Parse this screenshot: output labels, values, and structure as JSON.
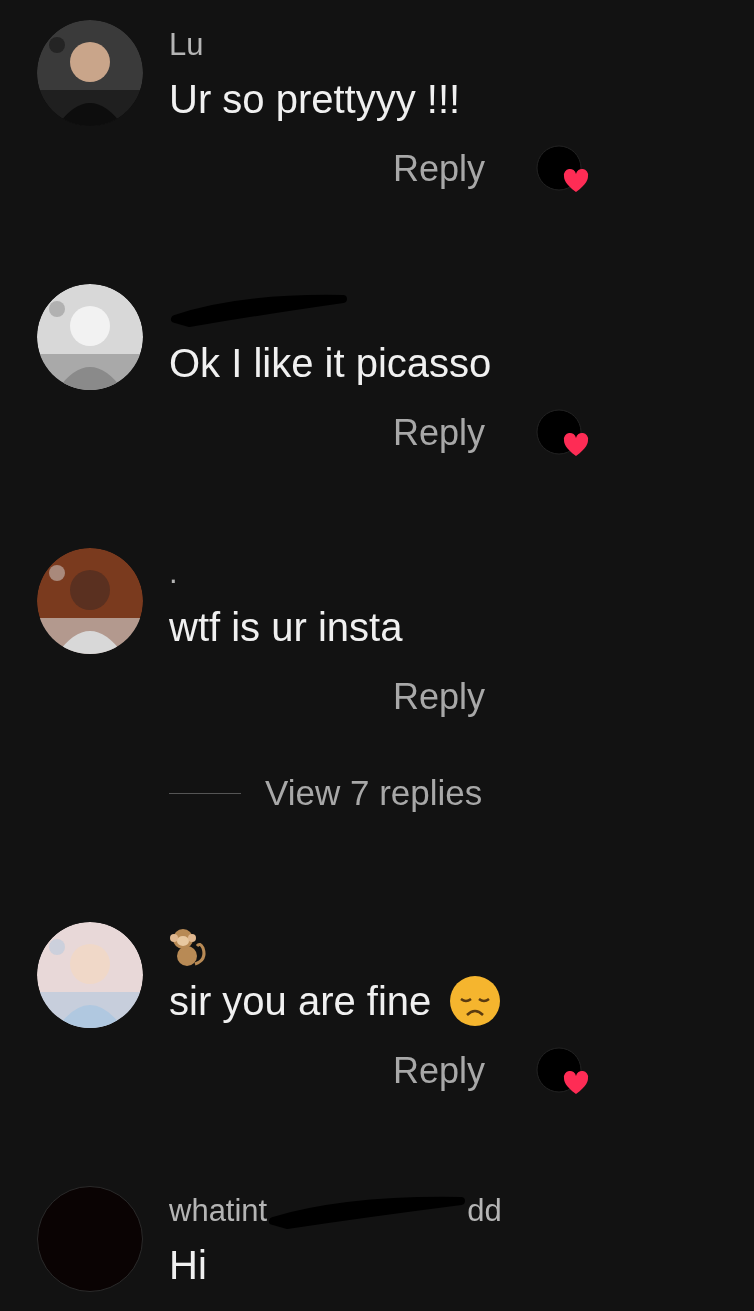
{
  "comments": [
    {
      "username": {
        "kind": "text",
        "text": "Lu"
      },
      "text": "Ur so prettyyy !!!",
      "reply": "Reply",
      "liked_by_creator": true
    },
    {
      "username": {
        "kind": "redacted"
      },
      "text": "Ok I like it picasso",
      "reply": "Reply",
      "liked_by_creator": true
    },
    {
      "username": {
        "kind": "text",
        "text": "."
      },
      "text": "wtf is ur insta",
      "reply": "Reply",
      "liked_by_creator": false,
      "view_replies": "View 7 replies"
    },
    {
      "username": {
        "kind": "monkey"
      },
      "text": "sir you are fine",
      "trailing_icon": {
        "kind": "sad_face"
      },
      "reply": "Reply",
      "liked_by_creator": true
    },
    {
      "avatar": {
        "kind": "plain"
      },
      "username": {
        "kind": "partly_redacted",
        "start": "whatint",
        "end": "dd"
      },
      "text": "Hi"
    }
  ]
}
